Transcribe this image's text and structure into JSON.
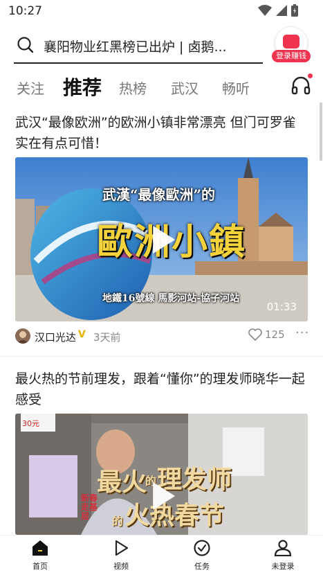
{
  "status": {
    "time": "10:27"
  },
  "search": {
    "text": "襄阳物业红黑榜已出炉 | 卤鹅...",
    "login_label": "登录赚钱"
  },
  "tabs": [
    "关注",
    "推荐",
    "热榜",
    "武汉",
    "畅听"
  ],
  "active_tab": "推荐",
  "feed": [
    {
      "title": "武汉“最像欧洲”的欧洲小镇非常漂亮 但门可罗雀 实在有点可惜！",
      "video": {
        "overlay_top": "武漢“最像歐洲”的",
        "overlay_main": "歐洲小鎮",
        "overlay_bottom": "地鐵16號線 馬影河站-協子河站",
        "duration": "01:33"
      },
      "author": "汉口光达",
      "verified_badge": "V",
      "time_ago": "3天前",
      "likes": "125"
    },
    {
      "title": "最火热的节前理发，跟着“懂你”的理发师晓华一起感受",
      "video": {
        "overlay_main_1": "最火",
        "overlay_small_1": "的",
        "overlay_main_2": "理发师",
        "overlay_side": "新春走基层",
        "overlay_small_2": "的",
        "overlay_main_3": "火热春节",
        "sign_text": "30元"
      }
    }
  ],
  "bottom_nav": [
    {
      "label": "首页",
      "icon": "home-icon"
    },
    {
      "label": "视频",
      "icon": "play-icon"
    },
    {
      "label": "任务",
      "icon": "check-circle-icon"
    },
    {
      "label": "未登录",
      "icon": "user-icon"
    }
  ],
  "colors": {
    "accent": "#f0344f",
    "home_accent": "#f5d33b"
  }
}
